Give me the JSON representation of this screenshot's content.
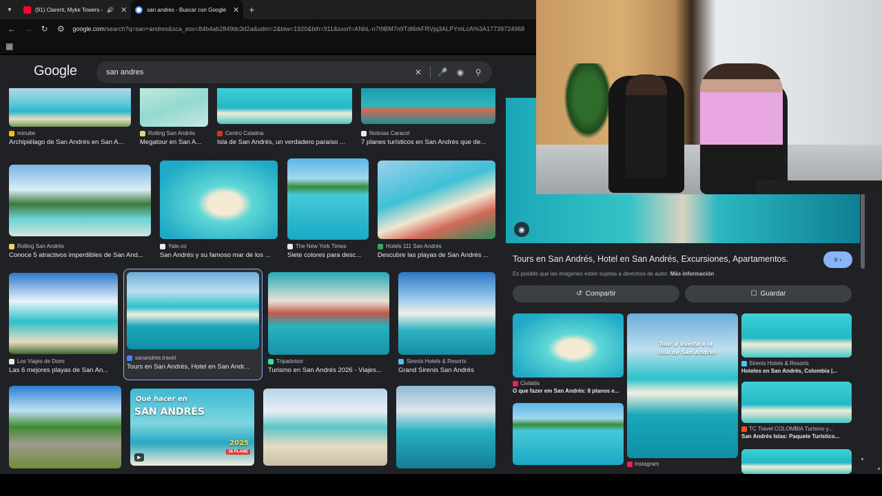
{
  "tabs": [
    {
      "label": "(91) Clarent, Myke Towers -",
      "favicon": "youtube-icon",
      "audio": true
    },
    {
      "label": "san andres - Buscar con Google",
      "favicon": "google-icon",
      "active": true
    }
  ],
  "address": {
    "host": "google.com",
    "path": "/search?q=san+andres&sca_esv=84b4ab2849dc3d2a&udm=2&biw=1920&bih=911&sxsrf=ANbL-n7t9BM7n9TdI6rkFRVjq3ALPYmLcA%3A17739724968"
  },
  "search": {
    "logo": "Google",
    "query": "san andres"
  },
  "results": [
    {
      "source": "minube",
      "title": "Archipiélago de San Andrés en San A...",
      "color": "#f4c20d"
    },
    {
      "source": "Rolling San Andrés",
      "title": "Megatour en San A...",
      "color": "#e6d36a"
    },
    {
      "source": "Centro Catalina",
      "title": "Isla de San Andrés, un verdadero paraíso ...",
      "color": "#d93025"
    },
    {
      "source": "Noticias Caracol",
      "title": "7 planes turísticos en San Andrés que de...",
      "color": "#e8eaed"
    },
    {
      "source": "Rolling San Andrés",
      "title": "Conoce 5 atractivos imperdibles de San And...",
      "color": "#e6d36a"
    },
    {
      "source": "Yate.co",
      "title": "San Andrés y su famoso mar de los ...",
      "color": "#e8eaed"
    },
    {
      "source": "The New York Times",
      "title": "Siete colores para desc...",
      "color": "#e8eaed"
    },
    {
      "source": "Hotels 111 San Andrés",
      "title": "Descubre las playas de San Andrés ...",
      "color": "#34a853"
    },
    {
      "source": "Los Viajes de Domi",
      "title": "Las 6 mejores playas de San An...",
      "color": "#e8eaed"
    },
    {
      "source": "sanandres.travel",
      "title": "Tours en San Andrés, Hotel en San Andr...",
      "color": "#4285f4"
    },
    {
      "source": "Tripadvisor",
      "title": "Turismo en San Andrés 2026 - Viajes...",
      "color": "#34e0a1"
    },
    {
      "source": "Sirenis Hotels & Resorts",
      "title": "Grand Sirenis San Andrés",
      "color": "#4fc3f7"
    }
  ],
  "overlay": {
    "quehacer_line1": "Qué hacer en",
    "quehacer_line2": "SAN ANDRÉS",
    "quehacer_year": "2025",
    "quehacer_tag": "18 PLANE"
  },
  "panel": {
    "title": "Tours en San Andrés, Hotel en San Andrés, Excursiones, Apartamentos.",
    "visit_label": "Ir",
    "copyright_note": "Es posible que las imágenes estén sujetas a derechos de autor.",
    "more_info": "Más información",
    "share_label": "Compartir",
    "save_label": "Guardar",
    "related": [
      {
        "source": "Civitatis",
        "title": "O que fazer em San Andrés: 8 planos e...",
        "color": "#e91e63"
      },
      {
        "source": "Sirenis Hotels & Resorts",
        "title": "Hoteles en San Andrés, Colombia |...",
        "color": "#4fc3f7"
      },
      {
        "source": "TC Travel COLOMBIA Turismo y...",
        "title": "San Andrés Islas: Paquete Turístico...",
        "color": "#f4511e"
      },
      {
        "source": "Instagram",
        "title": "",
        "color": "#e91e63",
        "overlay_line1": "Tour a Vuelta a la",
        "overlay_line2": "Isla de San Andrés"
      }
    ]
  }
}
